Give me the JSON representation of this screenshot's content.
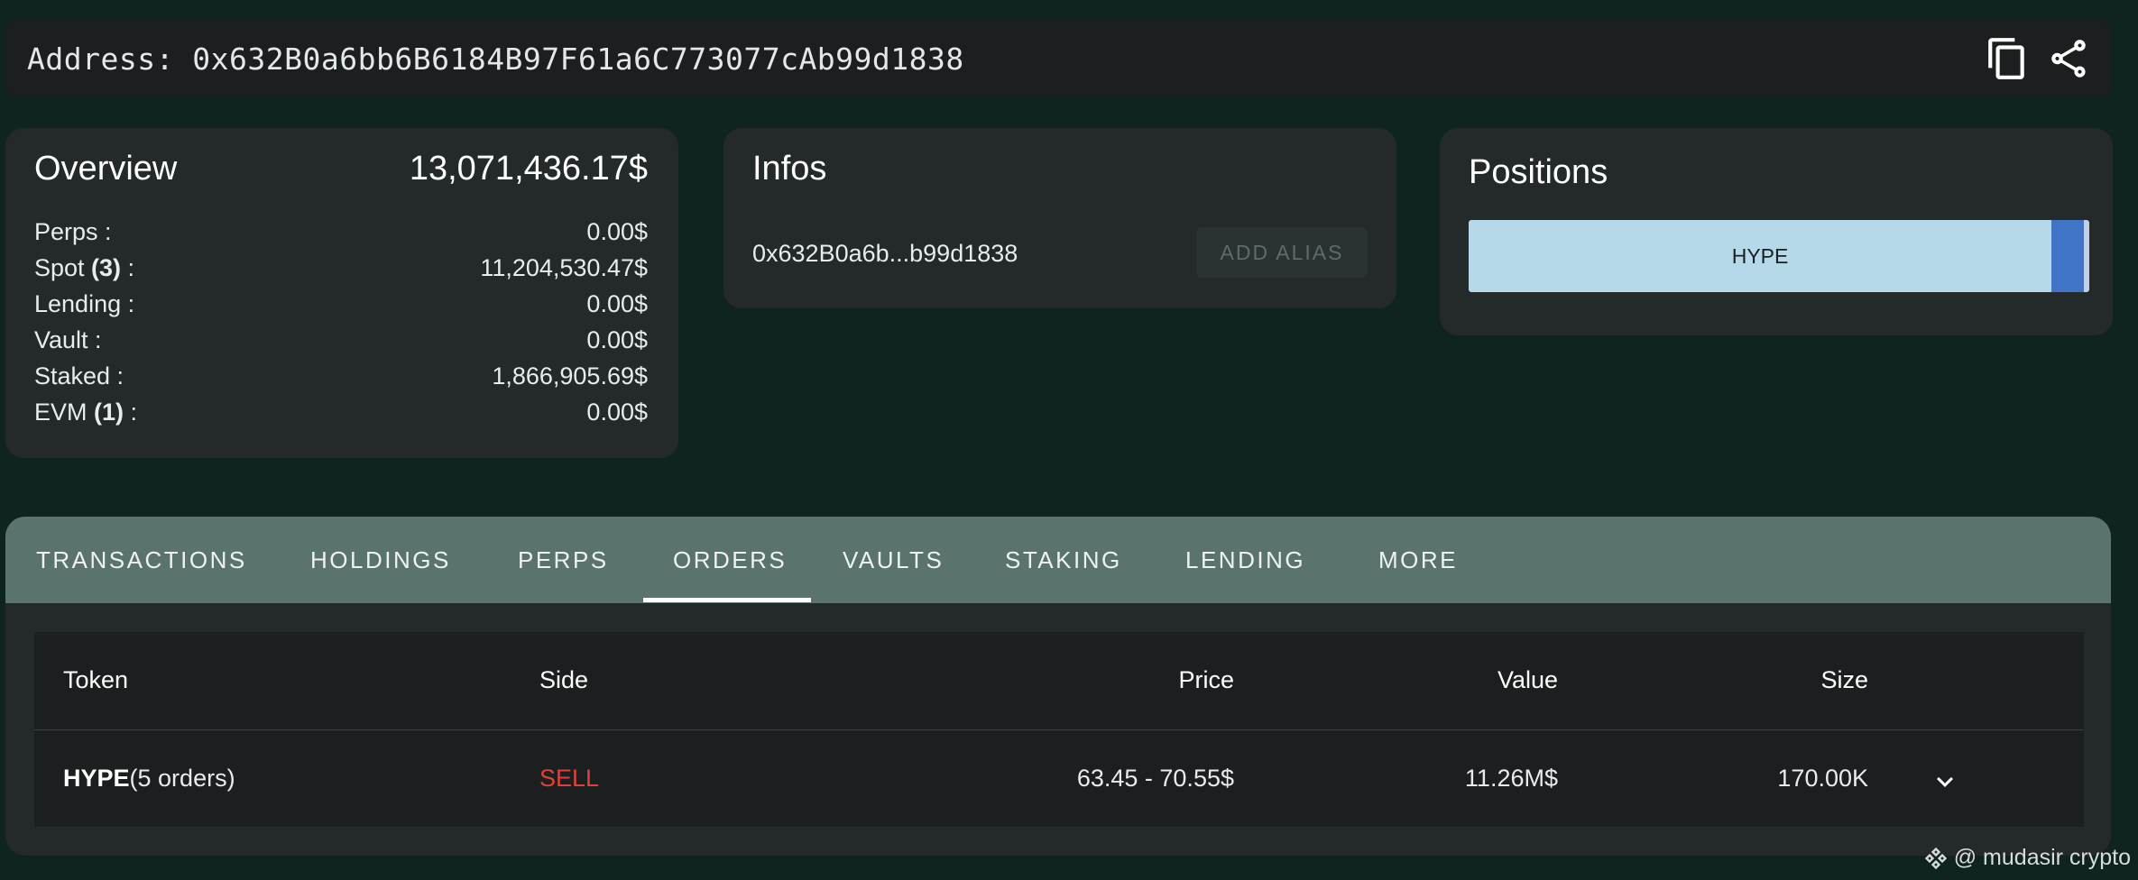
{
  "address_bar": {
    "text": "Address: 0x632B0a6bb6B6184B97F61a6C773077cAb99d1838",
    "copy_icon": "copy-icon",
    "share_icon": "share-icon"
  },
  "overview": {
    "title": "Overview",
    "total": "13,071,436.17$",
    "rows": [
      {
        "label": "Perps :",
        "count": "",
        "value": "0.00$"
      },
      {
        "label": "Spot ",
        "count": "(3)",
        "suffix": " :",
        "value": "11,204,530.47$"
      },
      {
        "label": "Lending :",
        "count": "",
        "value": "0.00$"
      },
      {
        "label": "Vault :",
        "count": "",
        "value": "0.00$"
      },
      {
        "label": "Staked :",
        "count": "",
        "value": "1,866,905.69$"
      },
      {
        "label": "EVM ",
        "count": "(1)",
        "suffix": " :",
        "value": "0.00$"
      }
    ]
  },
  "infos": {
    "title": "Infos",
    "short_address": "0x632B0a6b...b99d1838",
    "add_alias_label": "ADD ALIAS"
  },
  "positions": {
    "title": "Positions",
    "segments": [
      {
        "label": "HYPE",
        "share": 0.94,
        "color": "#b6d9ea"
      },
      {
        "label": "",
        "share": 0.052,
        "color": "#3f74c6"
      },
      {
        "label": "",
        "share": 0.008,
        "color": "#c0d0e8"
      }
    ]
  },
  "tabs": {
    "items": [
      "TRANSACTIONS",
      "HOLDINGS",
      "PERPS",
      "ORDERS",
      "VAULTS",
      "STAKING",
      "LENDING",
      "MORE"
    ],
    "active": "ORDERS"
  },
  "orders_table": {
    "headers": {
      "token": "Token",
      "side": "Side",
      "price": "Price",
      "value": "Value",
      "size": "Size"
    },
    "rows": [
      {
        "token": "HYPE",
        "token_suffix": "(5 orders)",
        "side": "SELL",
        "price": "63.45 - 70.55$",
        "value": "11.26M$",
        "size": "170.00K",
        "expand_icon": "chevron-down-icon"
      }
    ]
  },
  "watermark": {
    "icon": "binance-icon",
    "text": "@ mudasir crypto"
  },
  "colors": {
    "background": "#0f2320",
    "card": "#24292a",
    "tabbar": "#5a746d",
    "sell": "#e2413a"
  }
}
